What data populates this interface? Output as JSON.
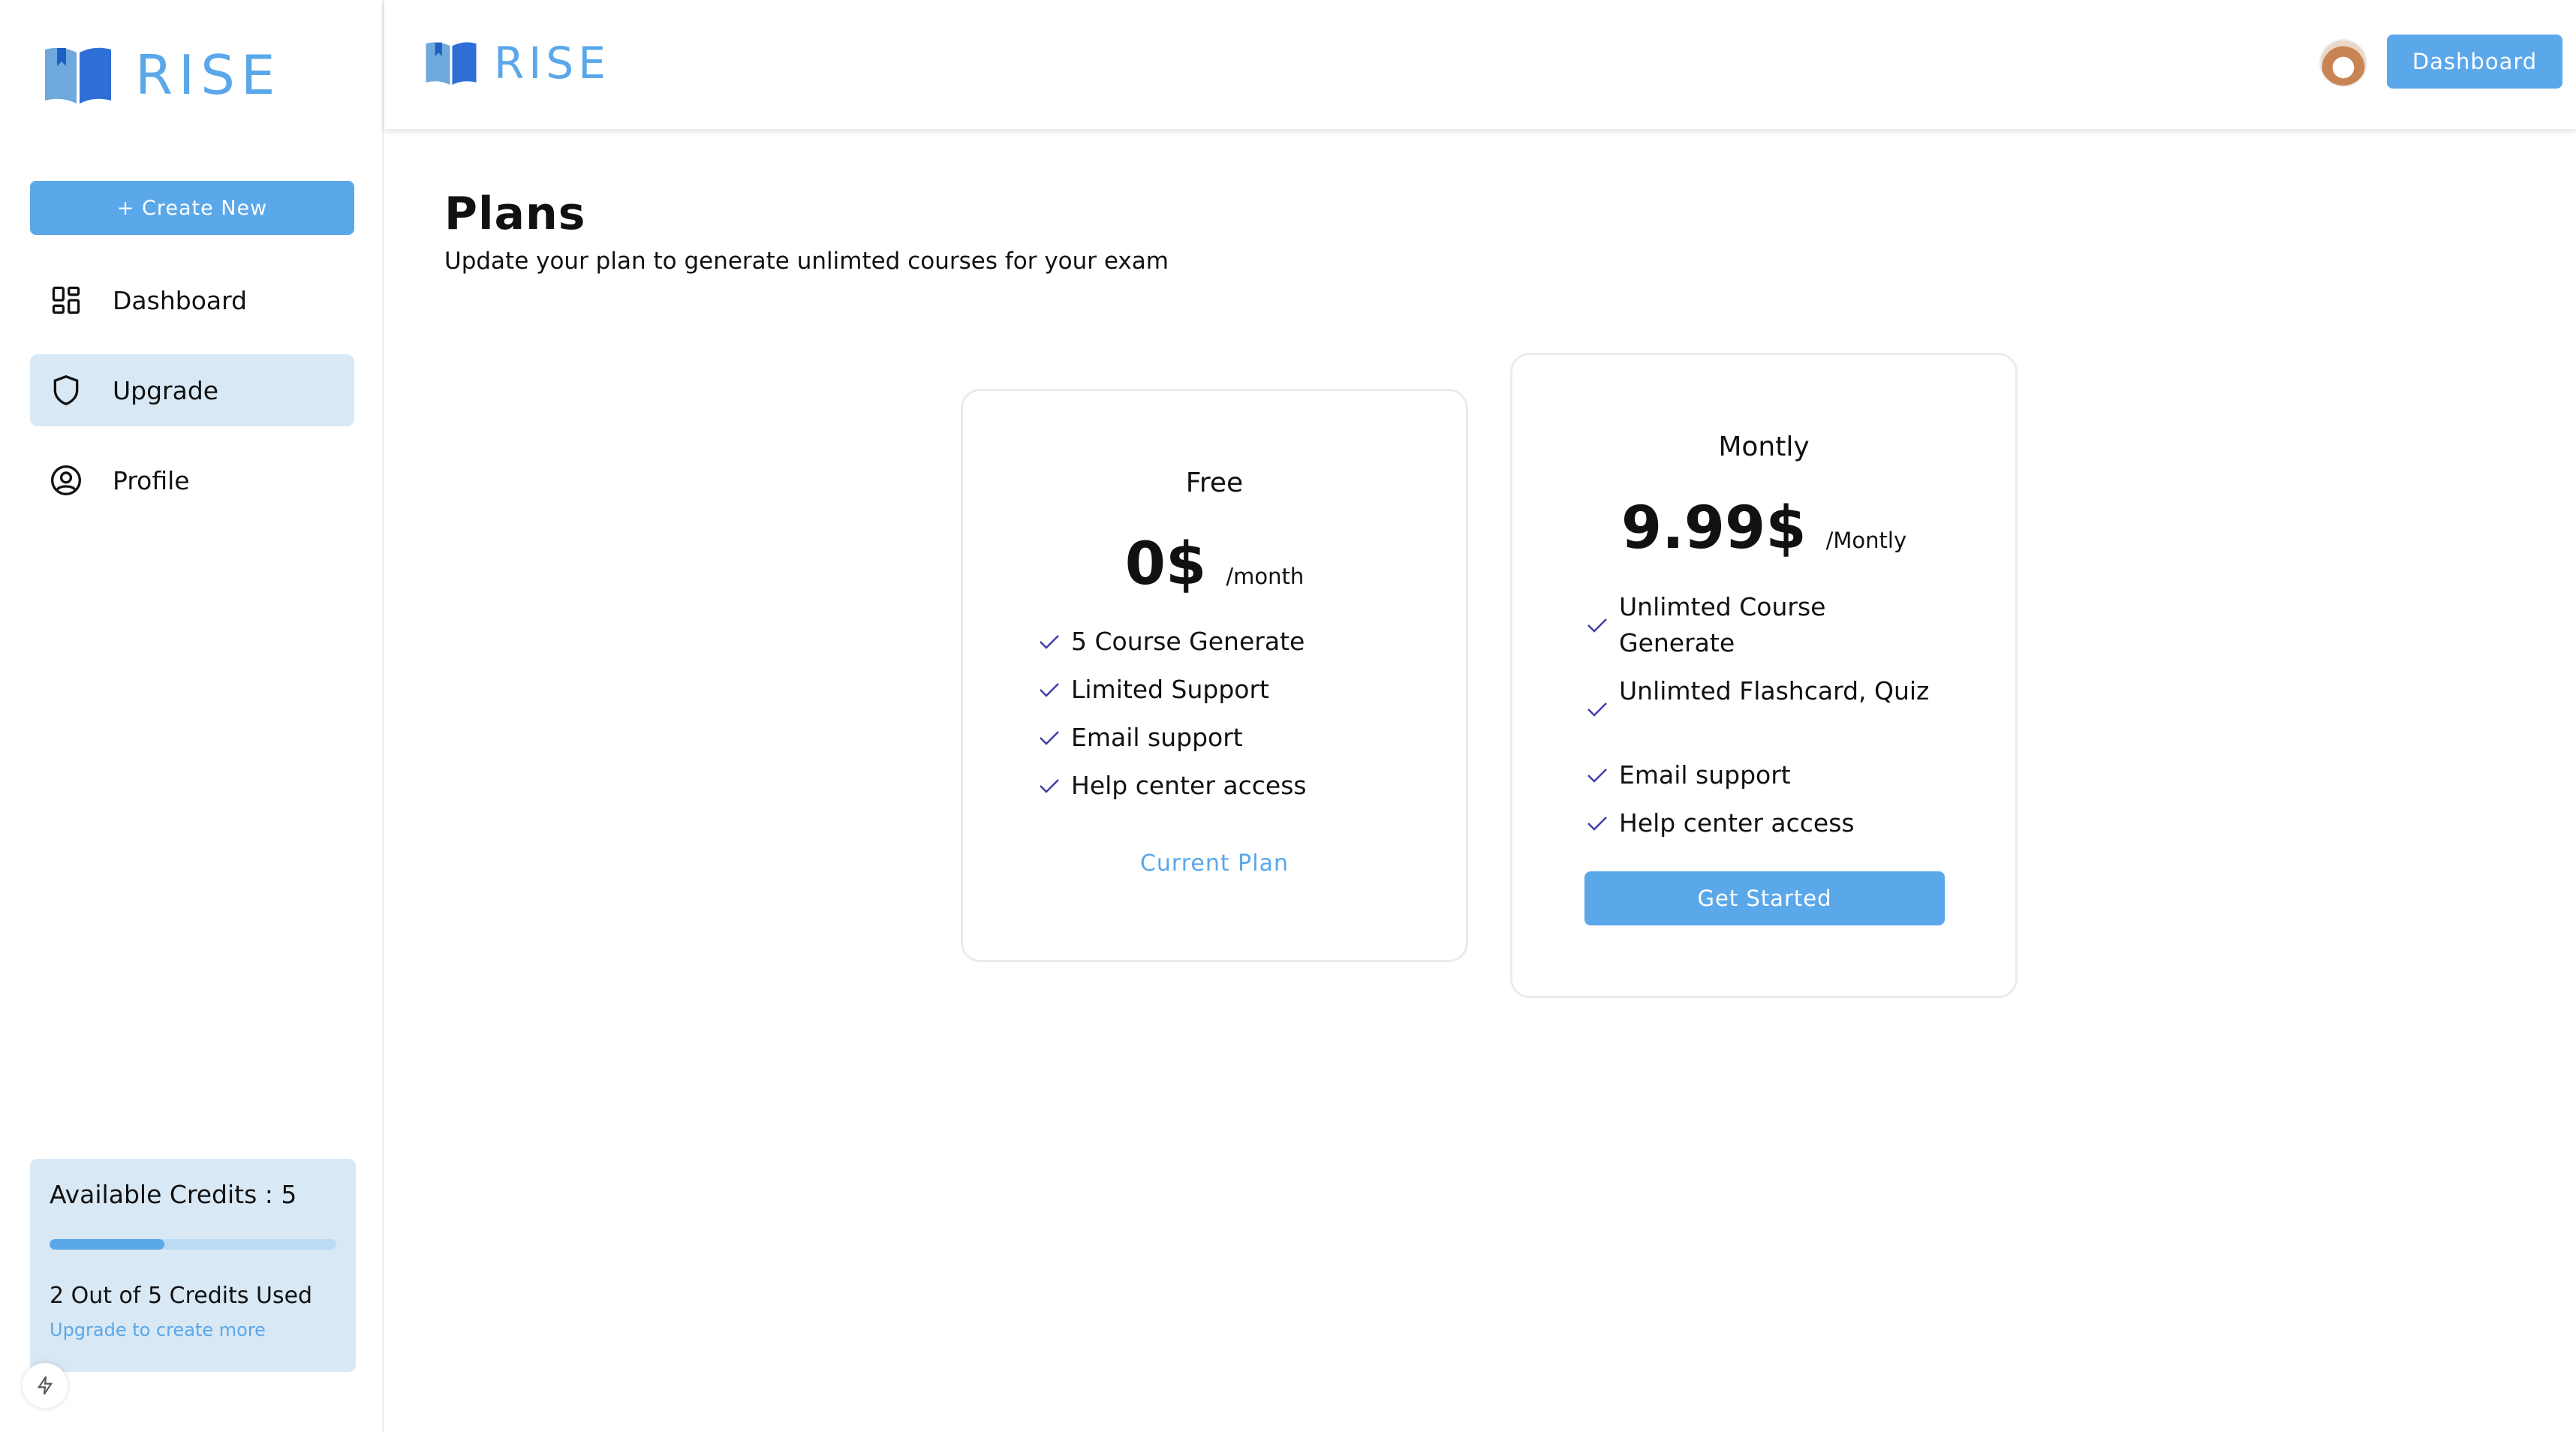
{
  "brand": {
    "name": "RISE"
  },
  "sidebar": {
    "create_label": "+ Create New",
    "items": [
      {
        "label": "Dashboard",
        "icon": "grid-icon"
      },
      {
        "label": "Upgrade",
        "icon": "shield-icon"
      },
      {
        "label": "Profile",
        "icon": "user-circle-icon"
      }
    ],
    "credits": {
      "title": "Available Credits : 5",
      "used_text": "2 Out of 5 Credits Used",
      "link_text": "Upgrade to create more",
      "used": 2,
      "total": 5
    }
  },
  "header": {
    "button_label": "Dashboard"
  },
  "page": {
    "title": "Plans",
    "subtitle": "Update your plan to generate unlimted courses for your exam"
  },
  "plans": [
    {
      "name": "Free",
      "price": "0$",
      "period": "/month",
      "features": [
        "5 Course Generate",
        "Limited Support",
        "Email support",
        "Help center access"
      ],
      "action_label": "Current Plan"
    },
    {
      "name": "Montly",
      "price": "9.99$",
      "period": "/Montly",
      "features": [
        "Unlimted Course Generate",
        "Unlimted Flashcard, Quiz",
        "Email support",
        "Help center access"
      ],
      "action_label": "Get Started"
    }
  ],
  "colors": {
    "accent": "#5aa7ea",
    "accent_light": "#d9e8f5",
    "check": "#3f3fa8"
  }
}
